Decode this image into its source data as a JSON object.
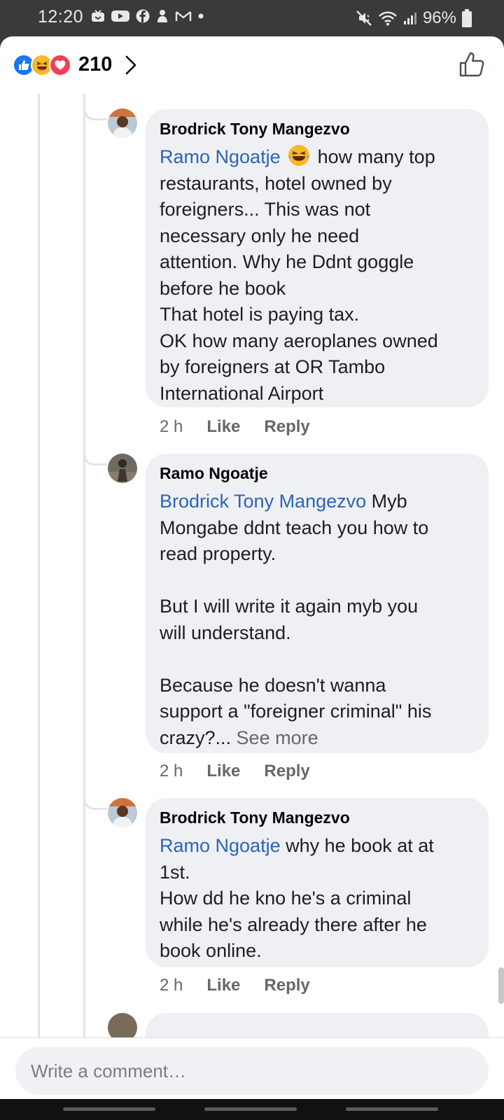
{
  "status_bar": {
    "time": "12:20",
    "battery": "96%",
    "left_icons": [
      "notification-icon",
      "youtube-icon",
      "facebook-icon",
      "app-icon",
      "gmail-icon",
      "dot-icon"
    ],
    "right_icons": [
      "mute-icon",
      "wifi-icon",
      "signal-icon",
      "battery-icon"
    ]
  },
  "header": {
    "reactions": [
      "like",
      "haha",
      "love"
    ],
    "reaction_count": "210"
  },
  "comments": [
    {
      "author": "Brodrick Tony Mangezvo",
      "mention": "Ramo Ngoatje",
      "lines": [
        "how many top",
        "restaurants, hotel owned by",
        "foreigners... This was not",
        "necessary only he need",
        "attention. Why he Ddnt goggle",
        "before he book",
        "That hotel is paying tax.",
        "OK how many aeroplanes owned",
        "by foreigners at OR Tambo",
        "International Airport"
      ],
      "time": "2 h",
      "like_label": "Like",
      "reply_label": "Reply"
    },
    {
      "author": "Ramo Ngoatje",
      "mention": "Brodrick Tony Mangezvo",
      "lines": [
        "Myb",
        "Mongabe ddnt teach you how to",
        "read property.",
        "",
        "But I will write it again myb you",
        "will understand.",
        "",
        "Because he doesn't wanna",
        "support a \"foreigner criminal\" his",
        "crazy?..."
      ],
      "see_more": "See more",
      "time": "2 h",
      "like_label": "Like",
      "reply_label": "Reply"
    },
    {
      "author": "Brodrick Tony Mangezvo",
      "mention": "Ramo Ngoatje",
      "lines": [
        "why he book at at",
        "1st.",
        "How dd he kno he's a criminal",
        "while he's already there after he",
        "book online."
      ],
      "time": "2 h",
      "like_label": "Like",
      "reply_label": "Reply"
    }
  ],
  "composer": {
    "placeholder": "Write a comment…"
  },
  "colors": {
    "link": "#2a64b8",
    "bubble": "#eff0f4",
    "like_blue": "#1877f2",
    "love_red": "#f33e58",
    "haha_yellow": "#f7b928"
  }
}
